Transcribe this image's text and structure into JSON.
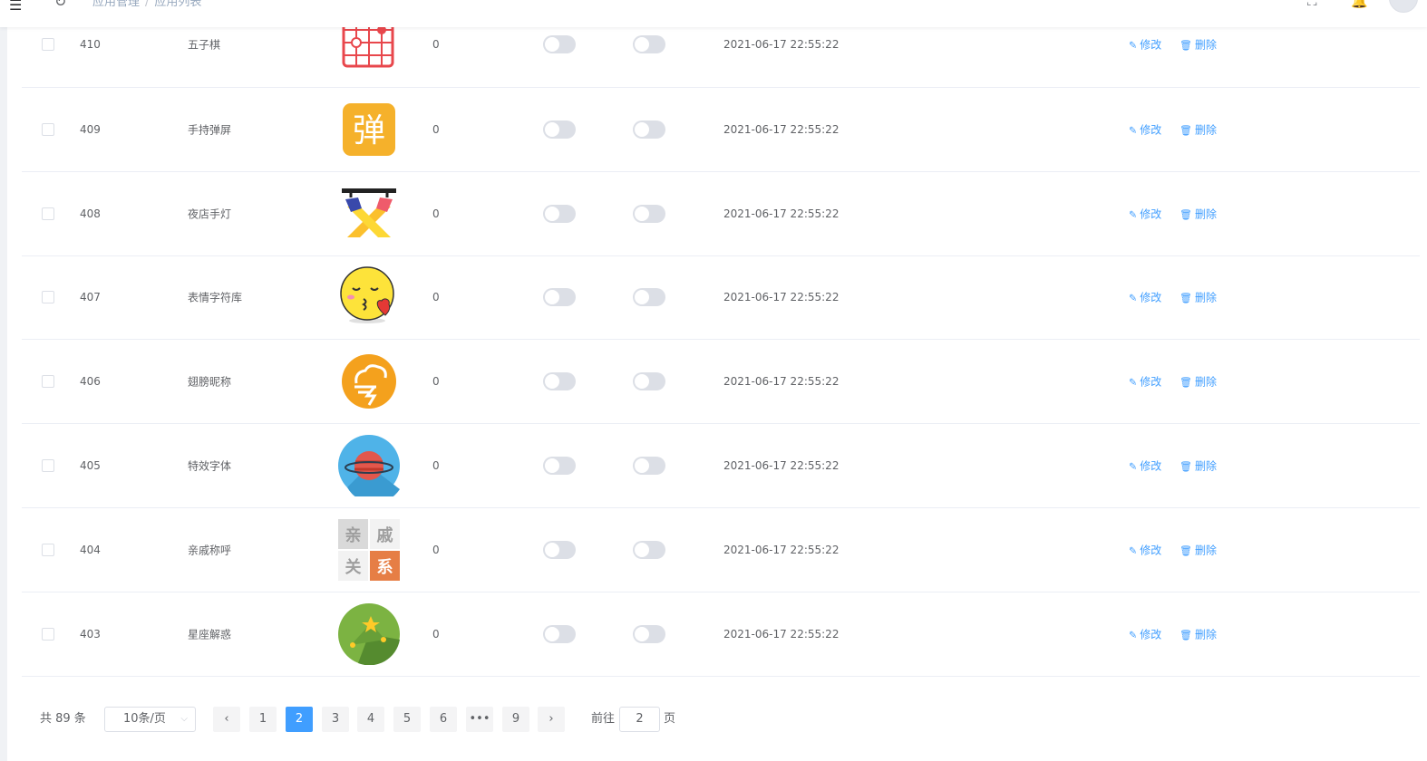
{
  "topbar": {
    "menu_icon": "☰",
    "refresh_icon": "↻",
    "breadcrumb_1": "应用管理",
    "breadcrumb_sep": "/",
    "breadcrumb_2": "应用列表",
    "fullscreen_icon": "⛶",
    "bell_icon": "🔔"
  },
  "table": {
    "rows": [
      {
        "id": "410",
        "name": "五子棋",
        "icon": "gomoku-icon",
        "count": "0",
        "switch_a": false,
        "switch_b": false,
        "time": "2021-06-17 22:55:22"
      },
      {
        "id": "409",
        "name": "手持弹屏",
        "icon": "danmu-icon",
        "count": "0",
        "switch_a": false,
        "switch_b": false,
        "time": "2021-06-17 22:55:22"
      },
      {
        "id": "408",
        "name": "夜店手灯",
        "icon": "club-light-icon",
        "count": "0",
        "switch_a": false,
        "switch_b": false,
        "time": "2021-06-17 22:55:22"
      },
      {
        "id": "407",
        "name": "表情字符库",
        "icon": "emoji-icon",
        "count": "0",
        "switch_a": false,
        "switch_b": false,
        "time": "2021-06-17 22:55:22"
      },
      {
        "id": "406",
        "name": "翅膀昵称",
        "icon": "wing-nickname-icon",
        "count": "0",
        "switch_a": false,
        "switch_b": false,
        "time": "2021-06-17 22:55:22"
      },
      {
        "id": "405",
        "name": "特效字体",
        "icon": "planet-icon",
        "count": "0",
        "switch_a": false,
        "switch_b": false,
        "time": "2021-06-17 22:55:22"
      },
      {
        "id": "404",
        "name": "亲戚称呼",
        "icon": "relatives-icon",
        "count": "0",
        "switch_a": false,
        "switch_b": false,
        "time": "2021-06-17 22:55:22"
      },
      {
        "id": "403",
        "name": "星座解惑",
        "icon": "constellation-icon",
        "count": "0",
        "switch_a": false,
        "switch_b": false,
        "time": "2021-06-17 22:55:22"
      }
    ],
    "edit_label": "修改",
    "delete_label": "删除",
    "edit_glyph": "✎",
    "delete_glyph": "🗑"
  },
  "icon_text": {
    "danmu": "弹",
    "rel_1": "亲",
    "rel_2": "戚",
    "rel_3": "关",
    "rel_4": "系"
  },
  "pagination": {
    "total": "共 89 条",
    "page_size": "10条/页",
    "prev": "‹",
    "next": "›",
    "pages": [
      "1",
      "2",
      "3",
      "4",
      "5",
      "6",
      "•••",
      "9"
    ],
    "current": "2",
    "goto_prefix": "前往",
    "goto_value": "2",
    "goto_suffix": "页"
  },
  "colors": {
    "primary": "#409eff",
    "switch_off": "#dcdfe6"
  }
}
